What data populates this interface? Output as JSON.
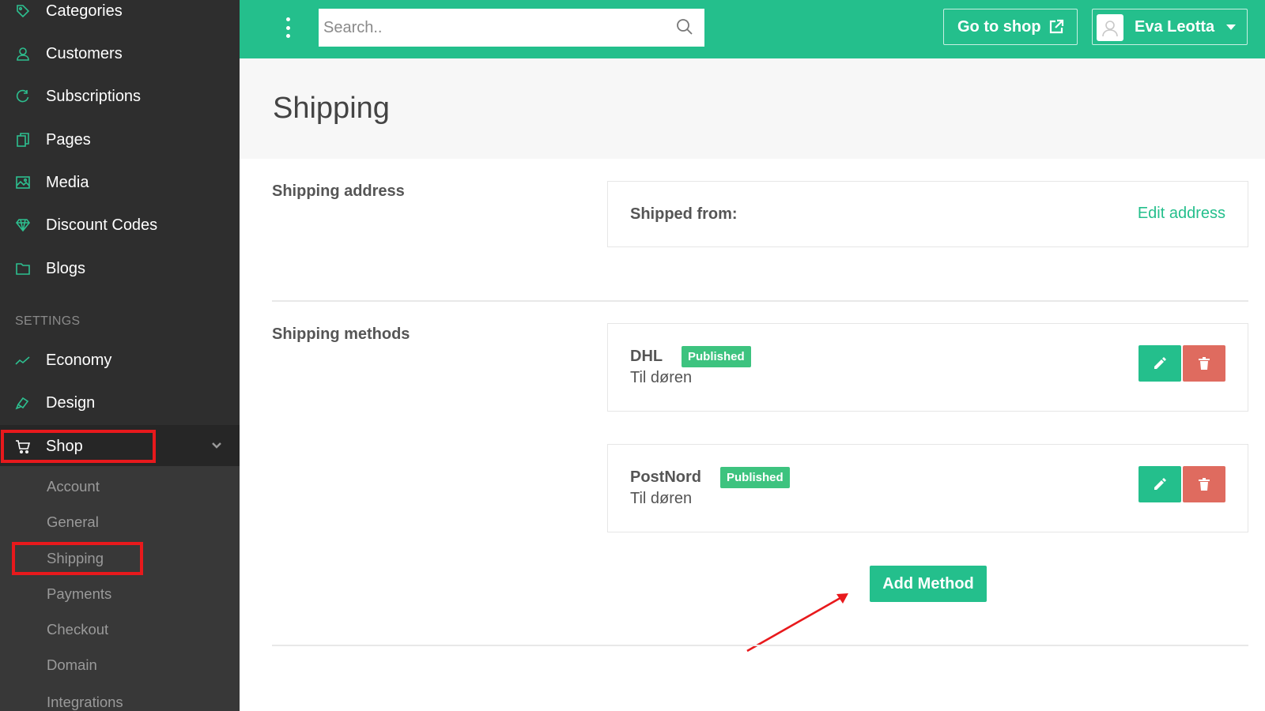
{
  "sidebar": {
    "items": [
      {
        "label": "Categories",
        "icon": "tag-icon"
      },
      {
        "label": "Customers",
        "icon": "user-icon"
      },
      {
        "label": "Subscriptions",
        "icon": "refresh-icon"
      },
      {
        "label": "Pages",
        "icon": "pages-icon"
      },
      {
        "label": "Media",
        "icon": "image-icon"
      },
      {
        "label": "Discount Codes",
        "icon": "diamond-icon"
      },
      {
        "label": "Blogs",
        "icon": "folder-icon"
      }
    ],
    "settings_label": "SETTINGS",
    "settings_items": [
      {
        "label": "Economy",
        "icon": "chart-line-icon"
      },
      {
        "label": "Design",
        "icon": "paint-icon"
      },
      {
        "label": "Shop",
        "icon": "cart-icon"
      }
    ],
    "shop_submenu": [
      "Account",
      "General",
      "Shipping",
      "Payments",
      "Checkout",
      "Domain",
      "Integrations"
    ]
  },
  "topbar": {
    "search_placeholder": "Search..",
    "goto_shop": "Go to shop",
    "user_name": "Eva Leotta"
  },
  "page": {
    "title": "Shipping"
  },
  "shipping_address": {
    "section_label": "Shipping address",
    "shipped_from_label": "Shipped from:",
    "edit_label": "Edit address"
  },
  "shipping_methods": {
    "section_label": "Shipping methods",
    "methods": [
      {
        "name": "DHL",
        "status": "Published",
        "description": "Til døren"
      },
      {
        "name": "PostNord",
        "status": "Published",
        "description": "Til døren"
      }
    ],
    "add_label": "Add Method"
  },
  "colors": {
    "accent": "#24bf8c",
    "sidebar_bg": "#2e2e2e",
    "danger": "#df6b5f",
    "highlight": "#e8191c"
  }
}
